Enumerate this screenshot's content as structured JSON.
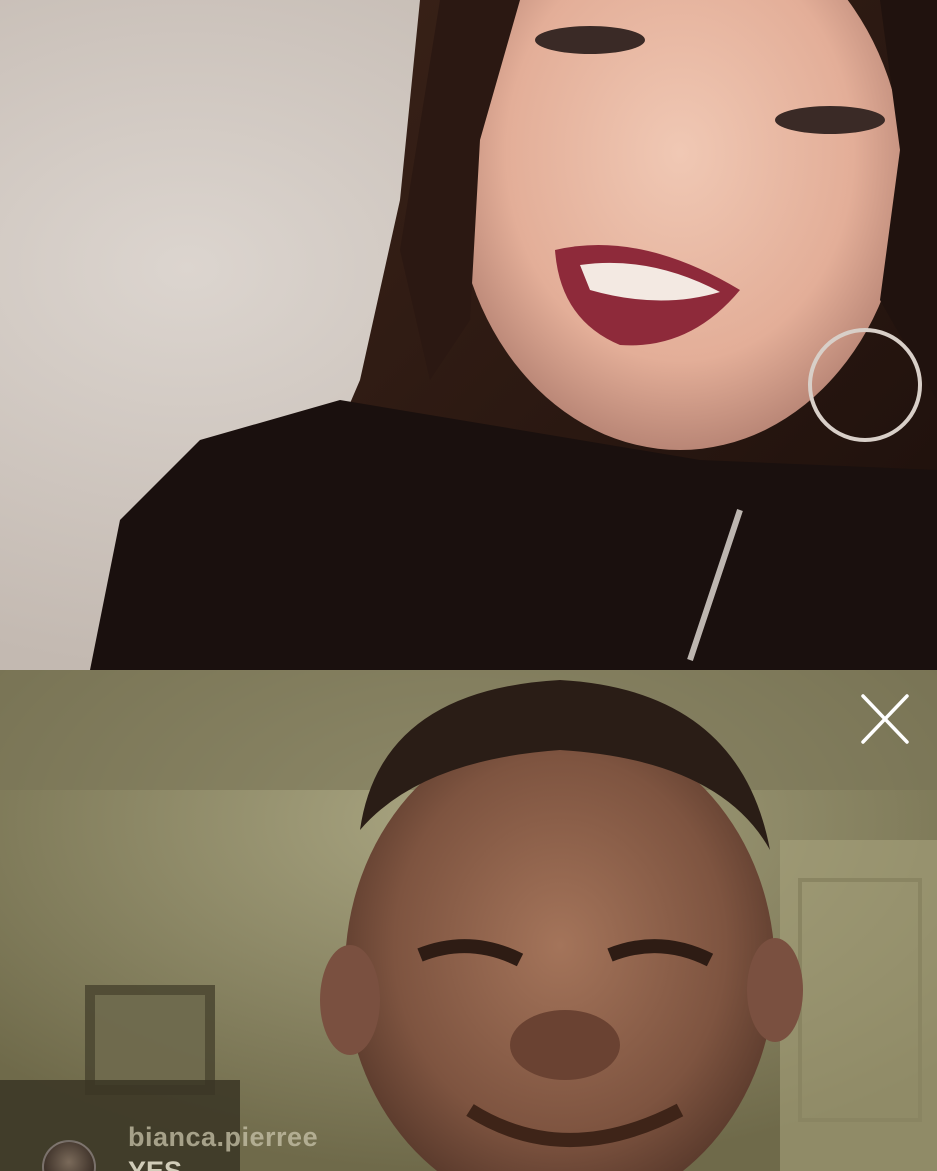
{
  "live_call": {
    "close_icon": "close-icon",
    "host_feed": {
      "description_icon": "video-feed"
    },
    "guest_feed": {
      "description_icon": "video-feed"
    }
  },
  "comment": {
    "username": "bianca.pierree",
    "text": "YES"
  },
  "colors": {
    "close_icon": "#ffffff",
    "divider": "#000000"
  }
}
